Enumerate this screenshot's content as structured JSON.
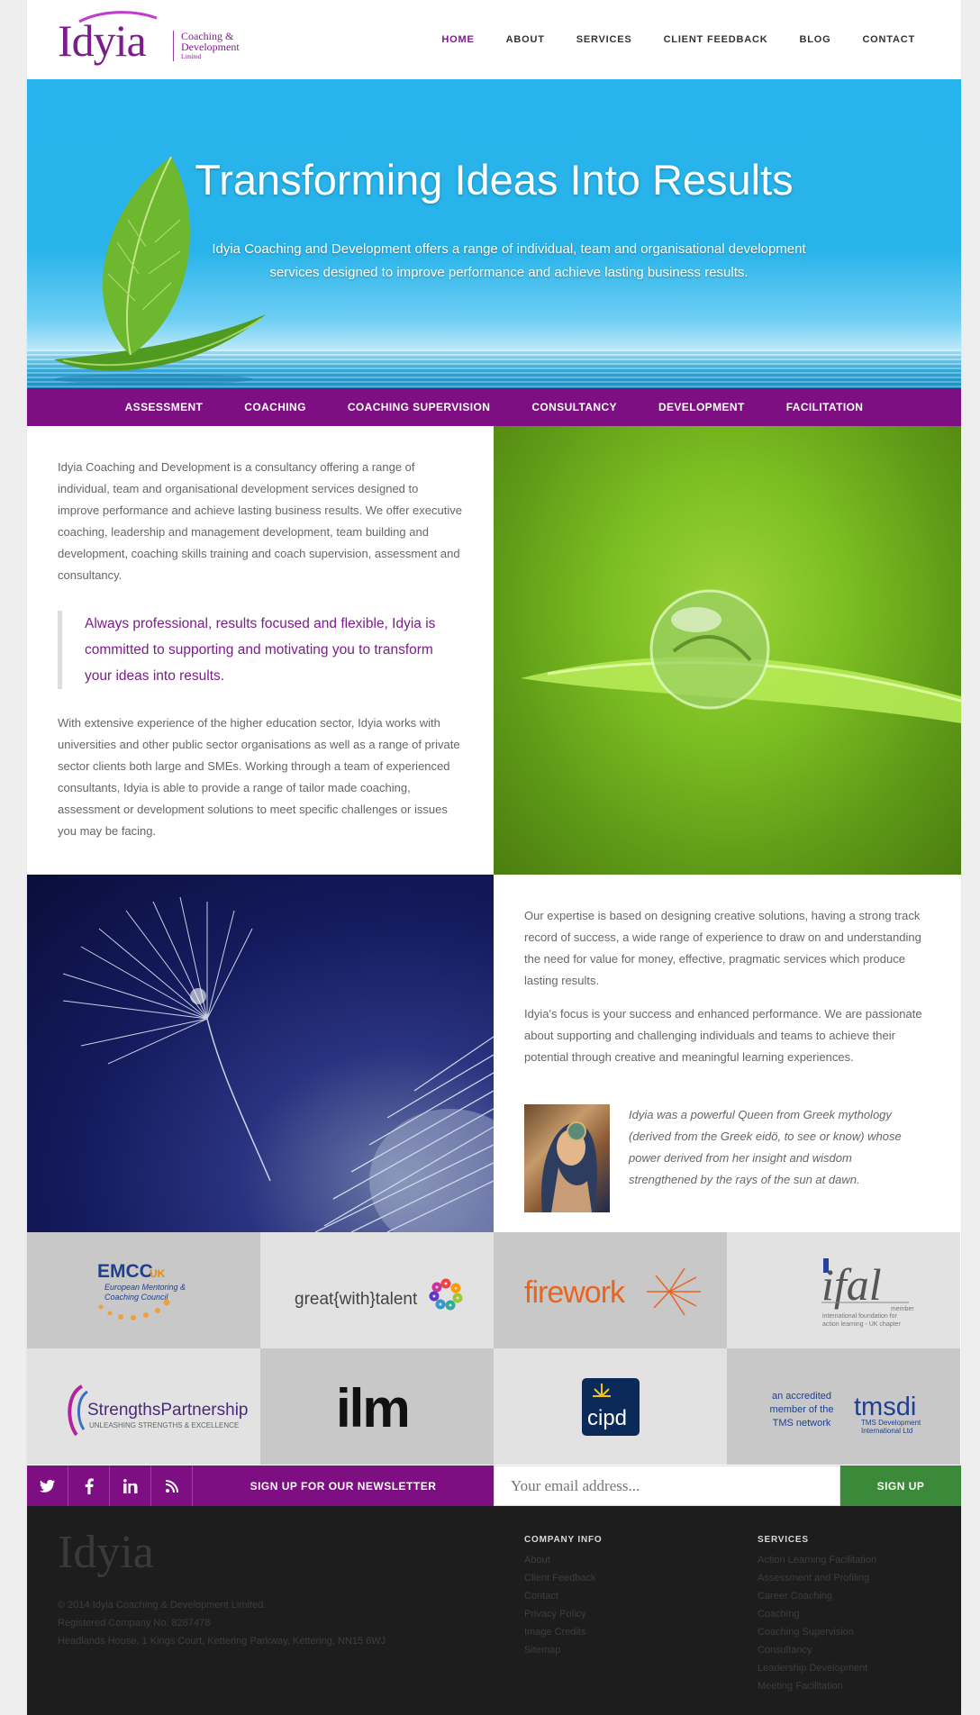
{
  "brand": {
    "name": "Idyia",
    "sub_line1": "Coaching &",
    "sub_line2": "Development",
    "sub_line3": "Limited",
    "color": "#7d1c8c"
  },
  "nav": [
    {
      "label": "HOME",
      "active": true
    },
    {
      "label": "ABOUT"
    },
    {
      "label": "SERVICES"
    },
    {
      "label": "CLIENT FEEDBACK"
    },
    {
      "label": "BLOG"
    },
    {
      "label": "CONTACT"
    }
  ],
  "hero": {
    "title": "Transforming Ideas Into Results",
    "text": "Idyia Coaching and Development offers a range of individual, team and organisational development services designed to improve performance and achieve lasting business results."
  },
  "services_bar": [
    "ASSESSMENT",
    "COACHING",
    "COACHING SUPERVISION",
    "CONSULTANCY",
    "DEVELOPMENT",
    "FACILITATION"
  ],
  "intro": {
    "p1": "Idyia Coaching and Development is a consultancy offering a range of individual, team and organisational development services designed to improve performance and achieve lasting business results. We offer executive coaching, leadership and management development, team building and development, coaching skills training and coach supervision, assessment and consultancy.",
    "quote": "Always professional, results focused and flexible, Idyia is committed to supporting and motivating you to transform your ideas into results.",
    "p2": "With extensive experience of the higher education sector, Idyia works with universities and other public sector organisations as well as a range of private sector clients both large and SMEs. Working through a team of experienced consultants, Idyia is able to provide a range of tailor made coaching, assessment or development solutions to meet specific challenges or issues you may be facing."
  },
  "about": {
    "p3": "Our expertise is based on designing creative solutions, having a strong track record of success, a wide range of experience to draw on and understanding the need for value for money, effective, pragmatic services which produce lasting results.",
    "p4": "Idyia's focus is your success and enhanced performance. We are passionate about supporting and challenging individuals and teams to achieve their potential through creative and meaningful learning experiences.",
    "myth": "Idyia was a powerful Queen from Greek mythology (derived from the Greek eidö, to see or know) whose power derived from her insight and wisdom strengthened by the rays of the sun at dawn."
  },
  "partners": {
    "emcc_main": "EMCC",
    "emcc_uk": "UK",
    "emcc_line1": "European Mentoring &",
    "emcc_line2": "Coaching Council",
    "gwt": "great{with}talent",
    "firework": "firework",
    "ifal": "ifal",
    "ifal_member": "member",
    "ifal_line1": "international foundation for",
    "ifal_line2": "action learning - UK chapter",
    "strengths": "StrengthsPartnership",
    "strengths_tag": "UNLEASHING STRENGTHS & EXCELLENCE",
    "ilm": "ilm",
    "cipd": "cipd",
    "tms_line1": "an accredited",
    "tms_line2": "member of the",
    "tms_line3": "TMS network",
    "tmsdi": "tmsdi",
    "tmsdi_sub1": "TMS Development",
    "tmsdi_sub2": "International Ltd"
  },
  "newsletter": {
    "label": "SIGN UP FOR OUR NEWSLETTER",
    "placeholder": "Your email address...",
    "button": "SIGN UP"
  },
  "footer": {
    "logo": "Idyia",
    "copyright": "© 2014 Idyia Coaching & Development Limited.",
    "company_no": "Registered Company No. 8267478",
    "address": "Headlands House, 1 Kings Court, Kettering Parkway, Kettering, NN15 6WJ",
    "company_heading": "COMPANY INFO",
    "company_links": [
      "About",
      "Client Feedback",
      "Contact",
      "Privacy Policy",
      "Image Credits",
      "Sitemap"
    ],
    "services_heading": "SERVICES",
    "services_links": [
      "Action Learning Facilitation",
      "Assessment and Profiling",
      "Career Coaching",
      "Coaching",
      "Coaching Supervision",
      "Consultancy",
      "Leadership Development",
      "Meeting Facilitation"
    ]
  }
}
